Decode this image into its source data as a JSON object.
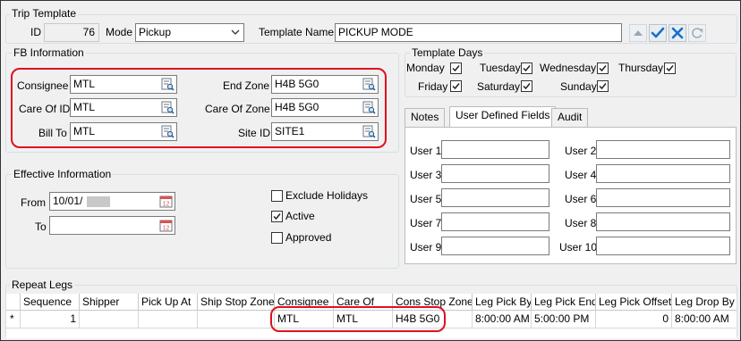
{
  "trip_template": {
    "group_label": "Trip Template",
    "id_label": "ID",
    "id_value": "76",
    "mode_label": "Mode",
    "mode_value": "Pickup",
    "template_name_label": "Template Name",
    "template_name_value": "PICKUP MODE"
  },
  "fb_information": {
    "group_label": "FB Information",
    "consignee_label": "Consignee",
    "consignee_value": "MTL",
    "care_of_id_label": "Care Of ID",
    "care_of_id_value": "MTL",
    "bill_to_label": "Bill To",
    "bill_to_value": "MTL",
    "end_zone_label": "End Zone",
    "end_zone_value": "H4B 5G0",
    "care_of_zone_label": "Care Of Zone",
    "care_of_zone_value": "H4B 5G0",
    "site_id_label": "Site ID",
    "site_id_value": "SITE1"
  },
  "template_days": {
    "group_label": "Template Days",
    "days": [
      {
        "label": "Monday",
        "checked": true
      },
      {
        "label": "Tuesday",
        "checked": true
      },
      {
        "label": "Wednesday",
        "checked": true
      },
      {
        "label": "Thursday",
        "checked": true
      },
      {
        "label": "Friday",
        "checked": true
      },
      {
        "label": "Saturday",
        "checked": true
      },
      {
        "label": "Sunday",
        "checked": true
      }
    ]
  },
  "tabs": {
    "notes": "Notes",
    "user_defined_fields": "User Defined Fields",
    "audit": "Audit"
  },
  "user_fields": {
    "left": [
      "User 1",
      "User 3",
      "User 5",
      "User 7",
      "User 9"
    ],
    "right": [
      "User 2",
      "User 4",
      "User 6",
      "User 8",
      "User 10"
    ]
  },
  "effective_information": {
    "group_label": "Effective Information",
    "from_label": "From",
    "from_value": "10/01/",
    "to_label": "To",
    "to_value": "",
    "exclude_holidays_label": "Exclude Holidays",
    "exclude_holidays_checked": false,
    "active_label": "Active",
    "active_checked": true,
    "approved_label": "Approved",
    "approved_checked": false
  },
  "repeat_legs": {
    "group_label": "Repeat Legs",
    "columns": [
      "Sequence",
      "Shipper",
      "Pick Up At",
      "Ship Stop Zone",
      "Consignee",
      "Care Of",
      "Cons Stop Zone",
      "Leg Pick By",
      "Leg Pick End",
      "Leg Pick Offset",
      "Leg Drop By"
    ],
    "rows": [
      {
        "indicator": "*",
        "cells": [
          "1",
          "",
          "",
          "",
          "MTL",
          "MTL",
          "H4B 5G0",
          "8:00:00 AM",
          "5:00:00 PM",
          "0",
          "8:00:00 AM"
        ]
      }
    ]
  },
  "colors": {
    "highlight_red": "#e0101e",
    "save_check_blue": "#1a6fc9",
    "cancel_x_blue": "#1a6fc9"
  }
}
